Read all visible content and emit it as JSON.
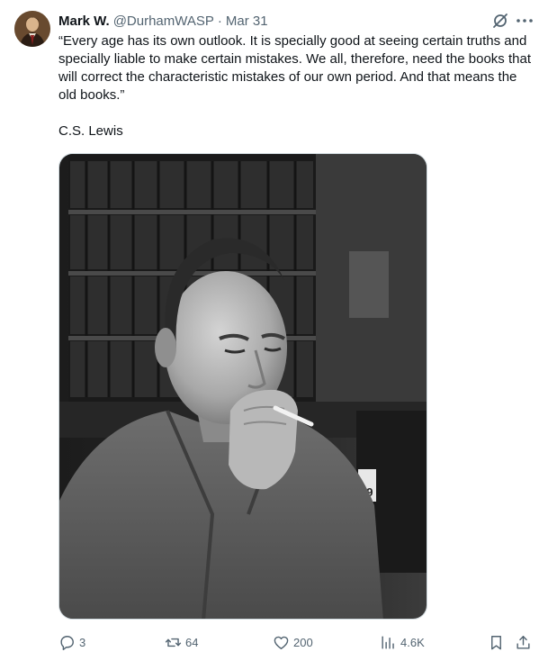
{
  "author": {
    "name": "Mark W.",
    "handle": "@DurhamWASP",
    "separator": "·",
    "date": "Mar 31"
  },
  "tweet": {
    "text": "“Every age has its own outlook. It is specially good at seeing certain truths and specially liable to make certain mistakes. We all, therefore, need the books that will correct the characteristic mistakes of our own period. And that means the old books.”",
    "attribution": "C.S. Lewis"
  },
  "media": {
    "sign_text": "29"
  },
  "actions": {
    "replies": "3",
    "reposts": "64",
    "likes": "200",
    "views": "4.6K"
  },
  "icons": {
    "header": [
      "grok-icon",
      "more-icon"
    ],
    "actions": [
      "reply-icon",
      "retweet-icon",
      "like-icon",
      "views-icon",
      "bookmark-icon",
      "share-icon"
    ]
  },
  "colors": {
    "text": "#0f1419",
    "secondary": "#536471",
    "border": "#cfd9de"
  }
}
